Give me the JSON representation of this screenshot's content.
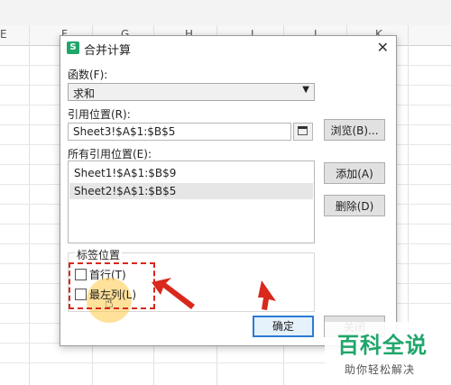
{
  "sheet": {
    "column_letters": [
      "E",
      "F",
      "G",
      "H",
      "I",
      "J",
      "K"
    ]
  },
  "dialog": {
    "title": "合并计算",
    "function_label": "函数(F):",
    "function_value": "求和",
    "reference_label": "引用位置(R):",
    "reference_value": "Sheet3!$A$1:$B$5",
    "browse_label": "浏览(B)...",
    "all_refs_label": "所有引用位置(E):",
    "all_refs": [
      "Sheet1!$A$1:$B$9",
      "Sheet2!$A$1:$B$5"
    ],
    "add_label": "添加(A)",
    "delete_label": "删除(D)",
    "label_position_title": "标签位置",
    "top_row_label": "首行(T)",
    "left_col_label": "最左列(L)",
    "ok_label": "确定",
    "close_label": "关闭"
  },
  "watermark": {
    "logo": "百科全说",
    "subtitle": "助你轻松解决"
  },
  "colors": {
    "accent": "#2d7bd5",
    "annotation_red": "#d9281c",
    "brand_green": "#1fa66a"
  }
}
